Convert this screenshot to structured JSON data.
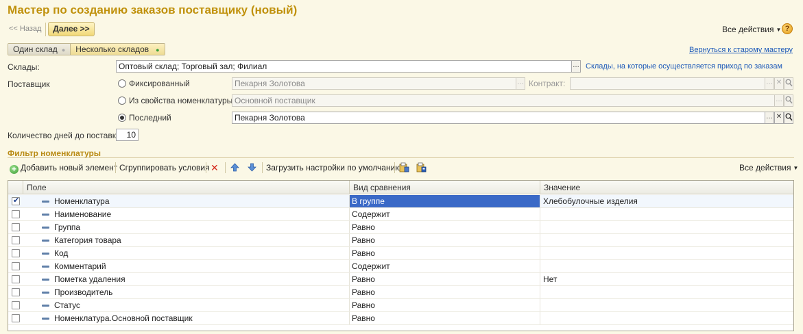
{
  "window": {
    "title": "Мастер по созданию заказов поставщику (новый)"
  },
  "nav": {
    "back_label": "<< Назад",
    "next_label": "Далее >>",
    "all_actions": "Все действия",
    "help": "?"
  },
  "mode": {
    "single_label": "Один склад",
    "multiple_label": "Несколько складов",
    "selected": "Несколько складов"
  },
  "old_master_link": "Вернуться к старому мастеру",
  "warehouses": {
    "label": "Склады:",
    "value": "Оптовый склад; Торговый зал; Филиал",
    "hint_link": "Склады, на которые осуществляется приход по заказам"
  },
  "supplier": {
    "label": "Поставщик",
    "options": [
      {
        "label": "Фиксированный",
        "value": "Пекарня Золотова",
        "selected": false
      },
      {
        "label": "Из свойства номенклатуры",
        "value": "Основной поставщик",
        "selected": false
      },
      {
        "label": "Последний",
        "value": "Пекарня Золотова",
        "selected": true
      }
    ],
    "contract_label": "Контракт:",
    "contract_value": ""
  },
  "delivery": {
    "label": "Количество дней до поставки:",
    "value": "10"
  },
  "filter": {
    "title": "Фильтр номенклатуры",
    "toolbar": {
      "add_label": "Добавить новый элемент",
      "group_label": "Сгруппировать условия",
      "load_defaults_label": "Загрузить настройки по умолчанию",
      "all_actions": "Все действия"
    },
    "columns": [
      "Поле",
      "Вид сравнения",
      "Значение"
    ],
    "rows": [
      {
        "checked": true,
        "field": "Номенклатура",
        "comparison": "В группе",
        "value": "Хлебобулочные изделия"
      },
      {
        "checked": false,
        "field": "Наименование",
        "comparison": "Содержит",
        "value": ""
      },
      {
        "checked": false,
        "field": "Группа",
        "comparison": "Равно",
        "value": ""
      },
      {
        "checked": false,
        "field": "Категория товара",
        "comparison": "Равно",
        "value": ""
      },
      {
        "checked": false,
        "field": "Код",
        "comparison": "Равно",
        "value": ""
      },
      {
        "checked": false,
        "field": "Комментарий",
        "comparison": "Содержит",
        "value": ""
      },
      {
        "checked": false,
        "field": "Пометка удаления",
        "comparison": "Равно",
        "value": "Нет"
      },
      {
        "checked": false,
        "field": "Производитель",
        "comparison": "Равно",
        "value": ""
      },
      {
        "checked": false,
        "field": "Статус",
        "comparison": "Равно",
        "value": ""
      },
      {
        "checked": false,
        "field": "Номенклатура.Основной поставщик",
        "comparison": "Равно",
        "value": ""
      }
    ]
  }
}
